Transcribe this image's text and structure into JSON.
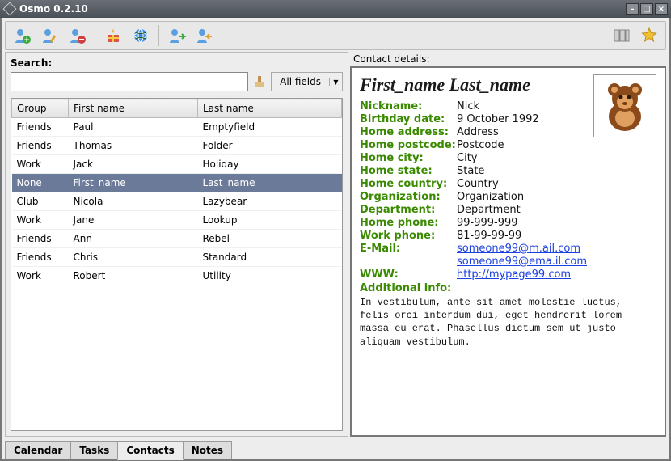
{
  "window": {
    "title": "Osmo 0.2.10"
  },
  "toolbar_icons": [
    "add-contact-icon",
    "edit-contact-icon",
    "remove-contact-icon",
    "birthday-icon",
    "web-icon",
    "import-icon",
    "export-icon",
    "columns-icon",
    "star-icon"
  ],
  "search": {
    "label": "Search:",
    "value": "",
    "field_filter": "All fields"
  },
  "columns": {
    "group": "Group",
    "first": "First name",
    "last": "Last name"
  },
  "contacts": [
    {
      "group": "Friends",
      "first": "Paul",
      "last": "Emptyfield",
      "selected": false
    },
    {
      "group": "Friends",
      "first": "Thomas",
      "last": "Folder",
      "selected": false
    },
    {
      "group": "Work",
      "first": "Jack",
      "last": "Holiday",
      "selected": false
    },
    {
      "group": "None",
      "first": "First_name",
      "last": "Last_name",
      "selected": true
    },
    {
      "group": "Club",
      "first": "Nicola",
      "last": "Lazybear",
      "selected": false
    },
    {
      "group": "Work",
      "first": "Jane",
      "last": "Lookup",
      "selected": false
    },
    {
      "group": "Friends",
      "first": "Ann",
      "last": "Rebel",
      "selected": false
    },
    {
      "group": "Friends",
      "first": "Chris",
      "last": "Standard",
      "selected": false
    },
    {
      "group": "Work",
      "first": "Robert",
      "last": "Utility",
      "selected": false
    }
  ],
  "details": {
    "panel_label": "Contact details:",
    "name": "First_name Last_name",
    "fields": [
      {
        "label": "Nickname:",
        "value": "Nick"
      },
      {
        "label": "Birthday date:",
        "value": "9 October 1992"
      },
      {
        "label": "Home address:",
        "value": "Address"
      },
      {
        "label": "Home postcode:",
        "value": "Postcode"
      },
      {
        "label": "Home city:",
        "value": "City"
      },
      {
        "label": "Home state:",
        "value": "State"
      },
      {
        "label": "Home country:",
        "value": "Country"
      },
      {
        "label": "Organization:",
        "value": "Organization"
      },
      {
        "label": "Department:",
        "value": "Department"
      },
      {
        "label": "Home phone:",
        "value": "99-999-999"
      },
      {
        "label": "Work phone:",
        "value": "81-99-99-99"
      }
    ],
    "email_label": "E-Mail:",
    "emails": [
      "someone99@m.ail.com",
      "someone99@ema.il.com"
    ],
    "www_label": "WWW:",
    "www": "http://mypage99.com",
    "addinfo_label": "Additional info:",
    "addinfo": "In vestibulum, ante sit amet molestie luctus, felis orci interdum dui, eget hendrerit lorem massa eu erat. Phasellus dictum sem ut justo aliquam vestibulum."
  },
  "tabs": [
    {
      "label": "Calendar",
      "active": false
    },
    {
      "label": "Tasks",
      "active": false
    },
    {
      "label": "Contacts",
      "active": true
    },
    {
      "label": "Notes",
      "active": false
    }
  ]
}
